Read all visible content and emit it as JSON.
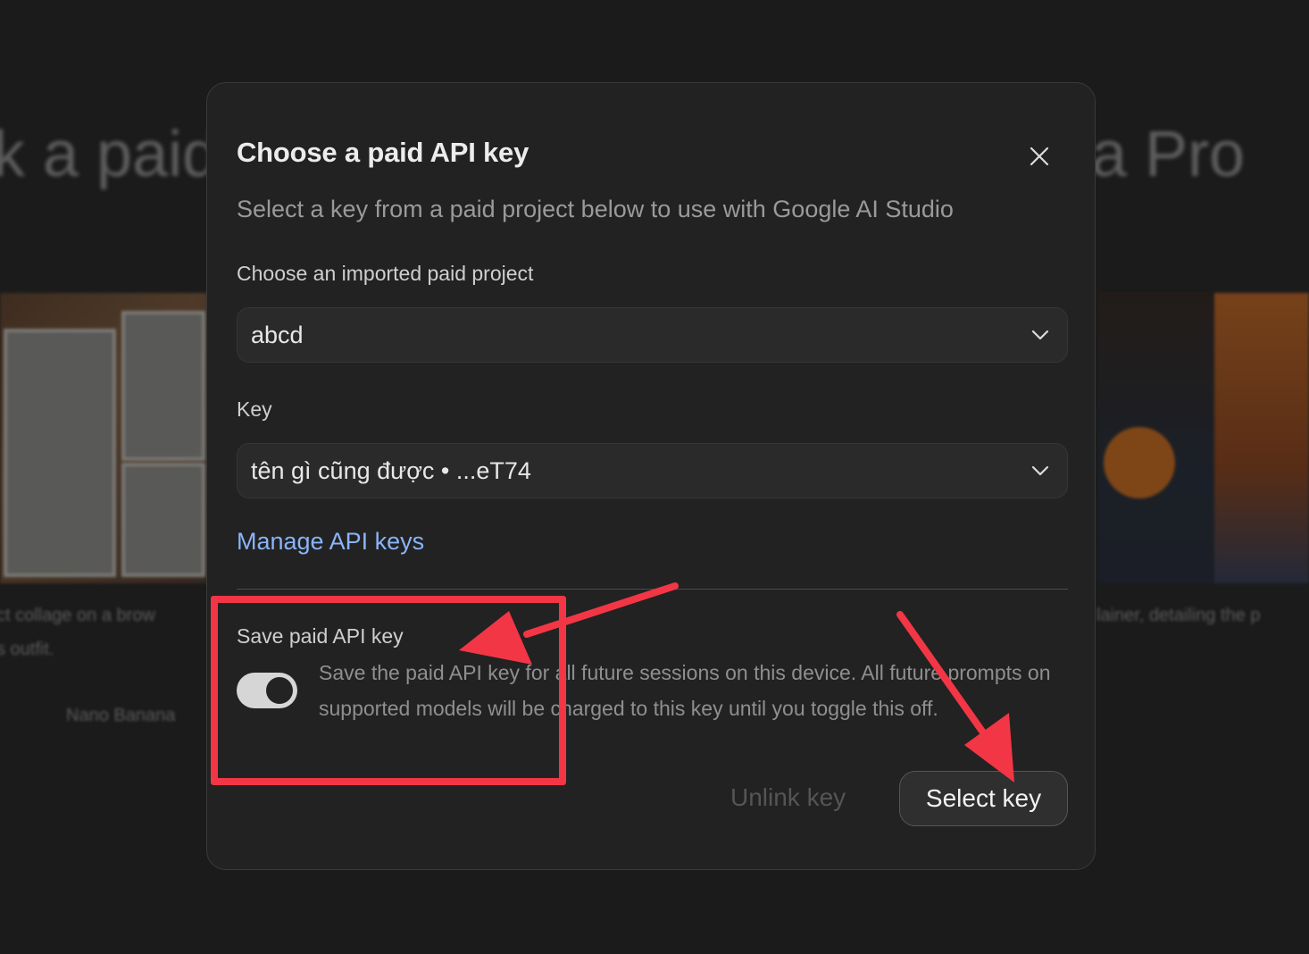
{
  "background": {
    "heading_left": "k a paid",
    "heading_right": "a Pro",
    "caption_left_1": "ct collage on a brow",
    "caption_left_2": "s outfit.",
    "caption_left_3": "Nano Banana",
    "caption_right": "lainer, detailing the p"
  },
  "dialog": {
    "title": "Choose a paid API key",
    "subtitle": "Select a key from a paid project below to use with Google AI Studio",
    "project_label": "Choose an imported paid project",
    "project_value": "abcd",
    "key_label": "Key",
    "key_value": "tên gì cũng được • ...eT74",
    "manage_link": "Manage API keys",
    "save_label": "Save paid API key",
    "save_toggle_on": true,
    "save_description": "Save the paid API key for all future sessions on this device. All future prompts on supported models will be charged to this key until you toggle this off.",
    "unlink_button": "Unlink key",
    "select_button": "Select key"
  },
  "icons": {
    "close": "close-icon",
    "dropdown": "chevron-down-icon"
  },
  "colors": {
    "link": "#8ab4f8",
    "annotation": "#f23645",
    "dialog_bg": "#222222"
  }
}
